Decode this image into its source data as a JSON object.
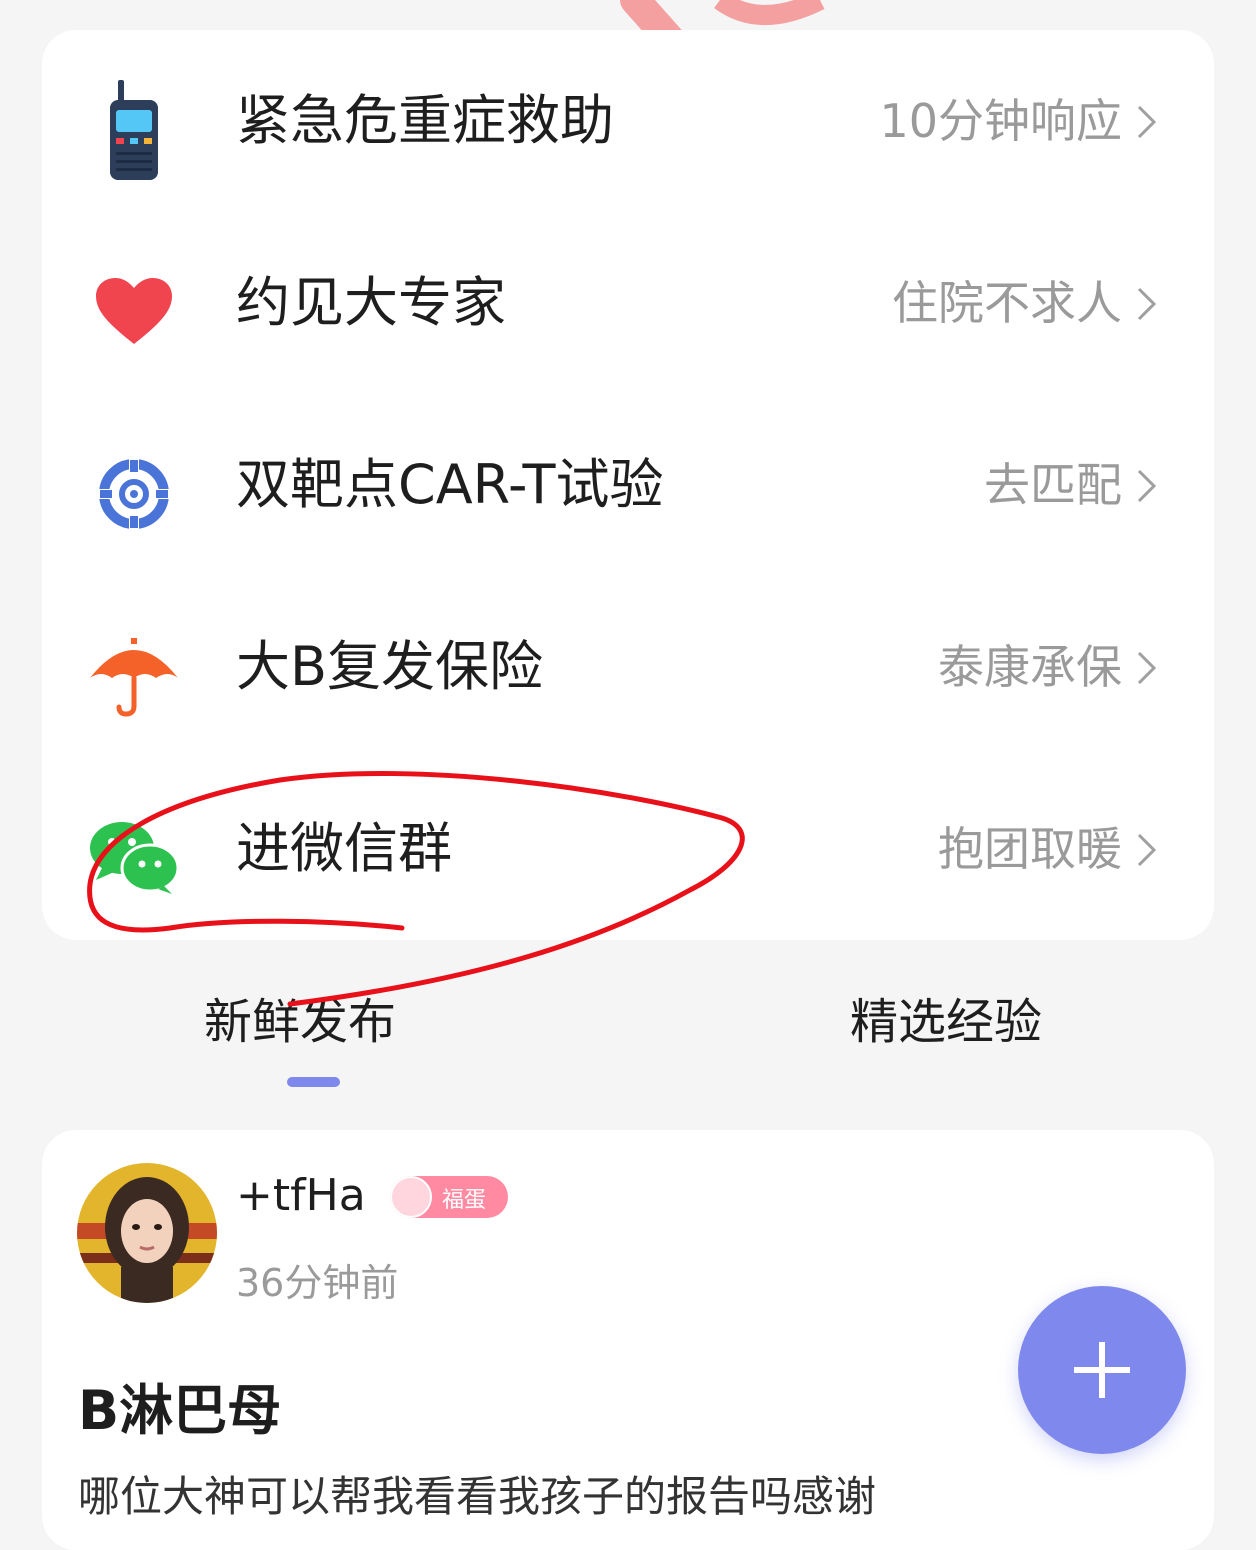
{
  "menu": {
    "items": [
      {
        "title": "紧急危重症救助",
        "subtitle": "10分钟响应",
        "icon": "walkie-talkie-icon"
      },
      {
        "title": "约见大专家",
        "subtitle": "住院不求人",
        "icon": "heart-icon"
      },
      {
        "title": "双靶点CAR-T试验",
        "subtitle": "去匹配",
        "icon": "target-icon"
      },
      {
        "title": "大B复发保险",
        "subtitle": "泰康承保",
        "icon": "umbrella-icon"
      },
      {
        "title": "进微信群",
        "subtitle": "抱团取暖",
        "icon": "wechat-icon"
      }
    ]
  },
  "tabs": {
    "fresh": "新鲜发布",
    "selected": "精选经验"
  },
  "post": {
    "username": "+tfHa",
    "badge": "福蛋",
    "time": "36分钟前",
    "title": "B淋巴母",
    "preview": "哪位大神可以帮我看看我孩子的报告吗感谢"
  },
  "colors": {
    "accent": "#7f88ec",
    "annotation_red": "#e8111a",
    "heart": "#f0454f",
    "target_blue": "#4a74d8",
    "umbrella": "#f4622a",
    "wechat_green": "#2dc14f"
  }
}
